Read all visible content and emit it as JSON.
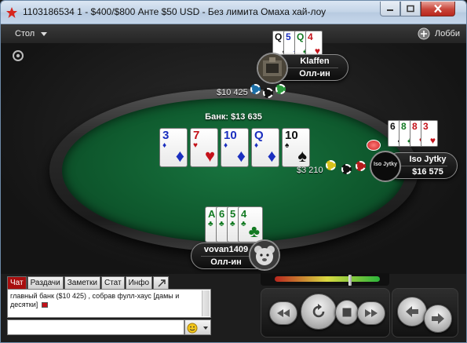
{
  "window": {
    "title": "1103186534 1 - $400/$800 Анте $50 USD - Без лимита Омаха хай-лоу"
  },
  "menu": {
    "table_label": "Стол",
    "lobby_label": "Лобби"
  },
  "pot": {
    "label": "Банк: $13 635"
  },
  "board": [
    {
      "rank": "3",
      "suit": "♦",
      "color": "d"
    },
    {
      "rank": "7",
      "suit": "♥",
      "color": "h"
    },
    {
      "rank": "10",
      "suit": "♦",
      "color": "d"
    },
    {
      "rank": "Q",
      "suit": "♦",
      "color": "d"
    },
    {
      "rank": "10",
      "suit": "♠",
      "color": "s"
    }
  ],
  "players": {
    "top": {
      "name": "Klaffen",
      "status": "Олл-ин",
      "bet": "$10 425",
      "cards": [
        {
          "rank": "Q",
          "suit": "♠",
          "color": "s"
        },
        {
          "rank": "5",
          "suit": "♦",
          "color": "d"
        },
        {
          "rank": "Q",
          "suit": "♣",
          "color": "c"
        },
        {
          "rank": "4",
          "suit": "♥",
          "color": "h"
        }
      ]
    },
    "right": {
      "name": "Iso Jytky",
      "stack": "$16 575",
      "avatar_text": "Iso Jytky",
      "bet": "$3 210",
      "cards": [
        {
          "rank": "6",
          "suit": "♠",
          "color": "s"
        },
        {
          "rank": "8",
          "suit": "♣",
          "color": "c"
        },
        {
          "rank": "8",
          "suit": "♥",
          "color": "h"
        },
        {
          "rank": "3",
          "suit": "♥",
          "color": "h"
        }
      ]
    },
    "hero": {
      "name": "vovan1409",
      "status": "Олл-ин",
      "cards": [
        {
          "rank": "A",
          "suit": "♣",
          "color": "c"
        },
        {
          "rank": "6",
          "suit": "♣",
          "color": "c"
        },
        {
          "rank": "5",
          "suit": "♣",
          "color": "c"
        },
        {
          "rank": "4",
          "suit": "♣",
          "color": "c"
        }
      ]
    }
  },
  "chat": {
    "tabs": [
      "Чат",
      "Раздачи",
      "Заметки",
      "Стат",
      "Инфо"
    ],
    "active_tab": "Чат",
    "message": "главный банк ($10 425) , собрав фулл-хаус [дамы и десятки]",
    "input_value": ""
  },
  "colors": {
    "felt": "#10612f",
    "hearts": "#c4121a",
    "diamonds": "#1b2fbf",
    "clubs": "#127a22",
    "spades": "#111111",
    "chat_active_tab": "#a80f0f"
  },
  "icons": [
    "pokerstars-logo-icon",
    "minimize-icon",
    "maximize-icon",
    "close-icon",
    "lobby-icon",
    "settings-icon",
    "dealer-button-icon",
    "popout-icon",
    "emoji-icon",
    "rewind-icon",
    "replay-icon",
    "stop-icon",
    "fast-forward-icon",
    "previous-hand-icon",
    "next-hand-icon"
  ]
}
